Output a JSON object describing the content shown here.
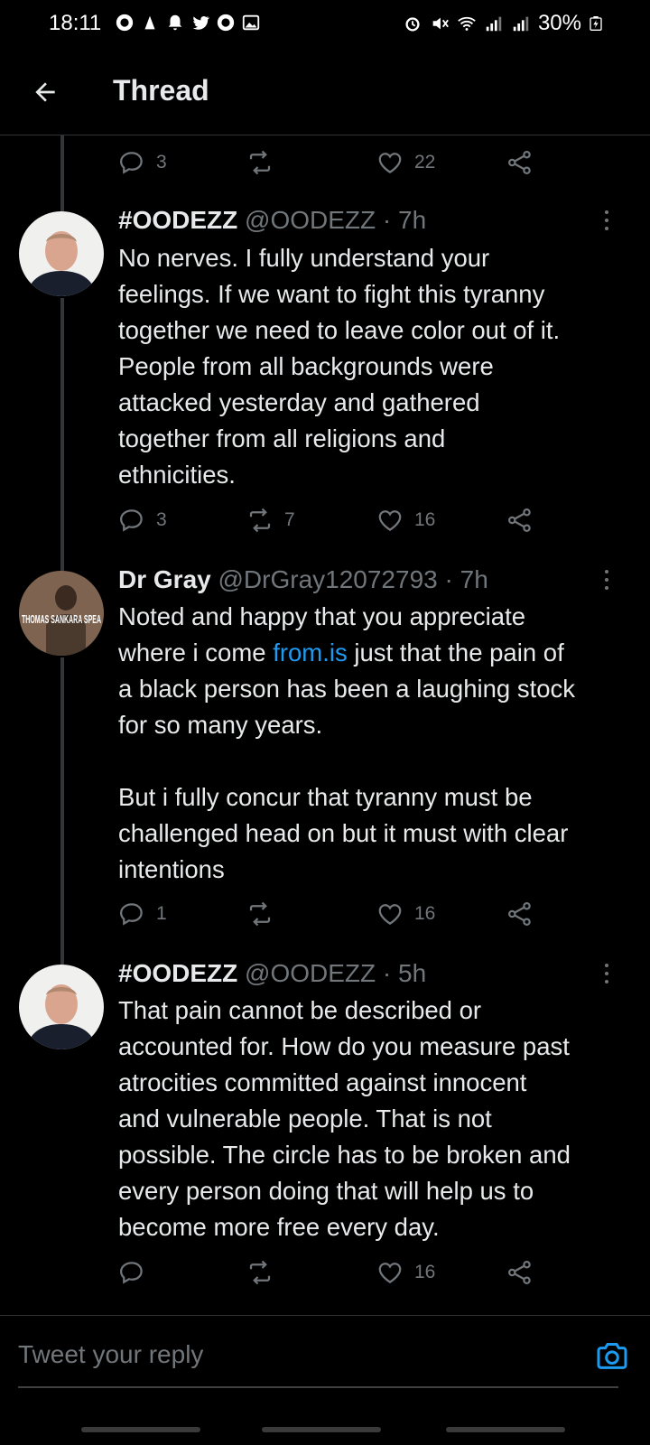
{
  "status_bar": {
    "time": "18:11",
    "battery": "30%"
  },
  "header": {
    "title": "Thread"
  },
  "top_actions": {
    "replies": "3",
    "retweets": "",
    "likes": "22"
  },
  "tweets": [
    {
      "name": "#OODEZZ",
      "handle": "@OODEZZ",
      "time": "7h",
      "text": "No nerves. I fully understand your\nfeelings. If we want to fight this tyranny\ntogether we need to leave color out of it.\nPeople from all backgrounds were\nattacked yesterday and gathered\ntogether from all religions and\nethnicities.",
      "replies": "3",
      "retweets": "7",
      "likes": "16"
    },
    {
      "name": "Dr Gray",
      "handle": "@DrGray12072793",
      "time": "7h",
      "avatar_text": "THOMAS SANKARA SPEA",
      "text_before_link": "Noted and happy that you appreciate\nwhere i come ",
      "link": "from.is",
      "text_after_link": " just that the pain of\na black person has been a laughing stock\nfor so many years.\n\nBut i fully concur that tyranny must be\nchallenged head on but it must with clear\nintentions",
      "replies": "1",
      "retweets": "",
      "likes": "16"
    },
    {
      "name": "#OODEZZ",
      "handle": "@OODEZZ",
      "time": "5h",
      "text": "That pain cannot be described or\naccounted for. How do you measure past\natrocities committed against innocent\nand vulnerable people. That is not\npossible. The circle has to be broken and\nevery person doing that will help us to\nbecome more free every day.",
      "replies": "",
      "retweets": "",
      "likes": "16"
    }
  ],
  "reply_bar": {
    "placeholder": "Tweet your reply"
  },
  "colors": {
    "accent": "#1d9bf0",
    "muted": "#71767b",
    "background": "#000000"
  }
}
